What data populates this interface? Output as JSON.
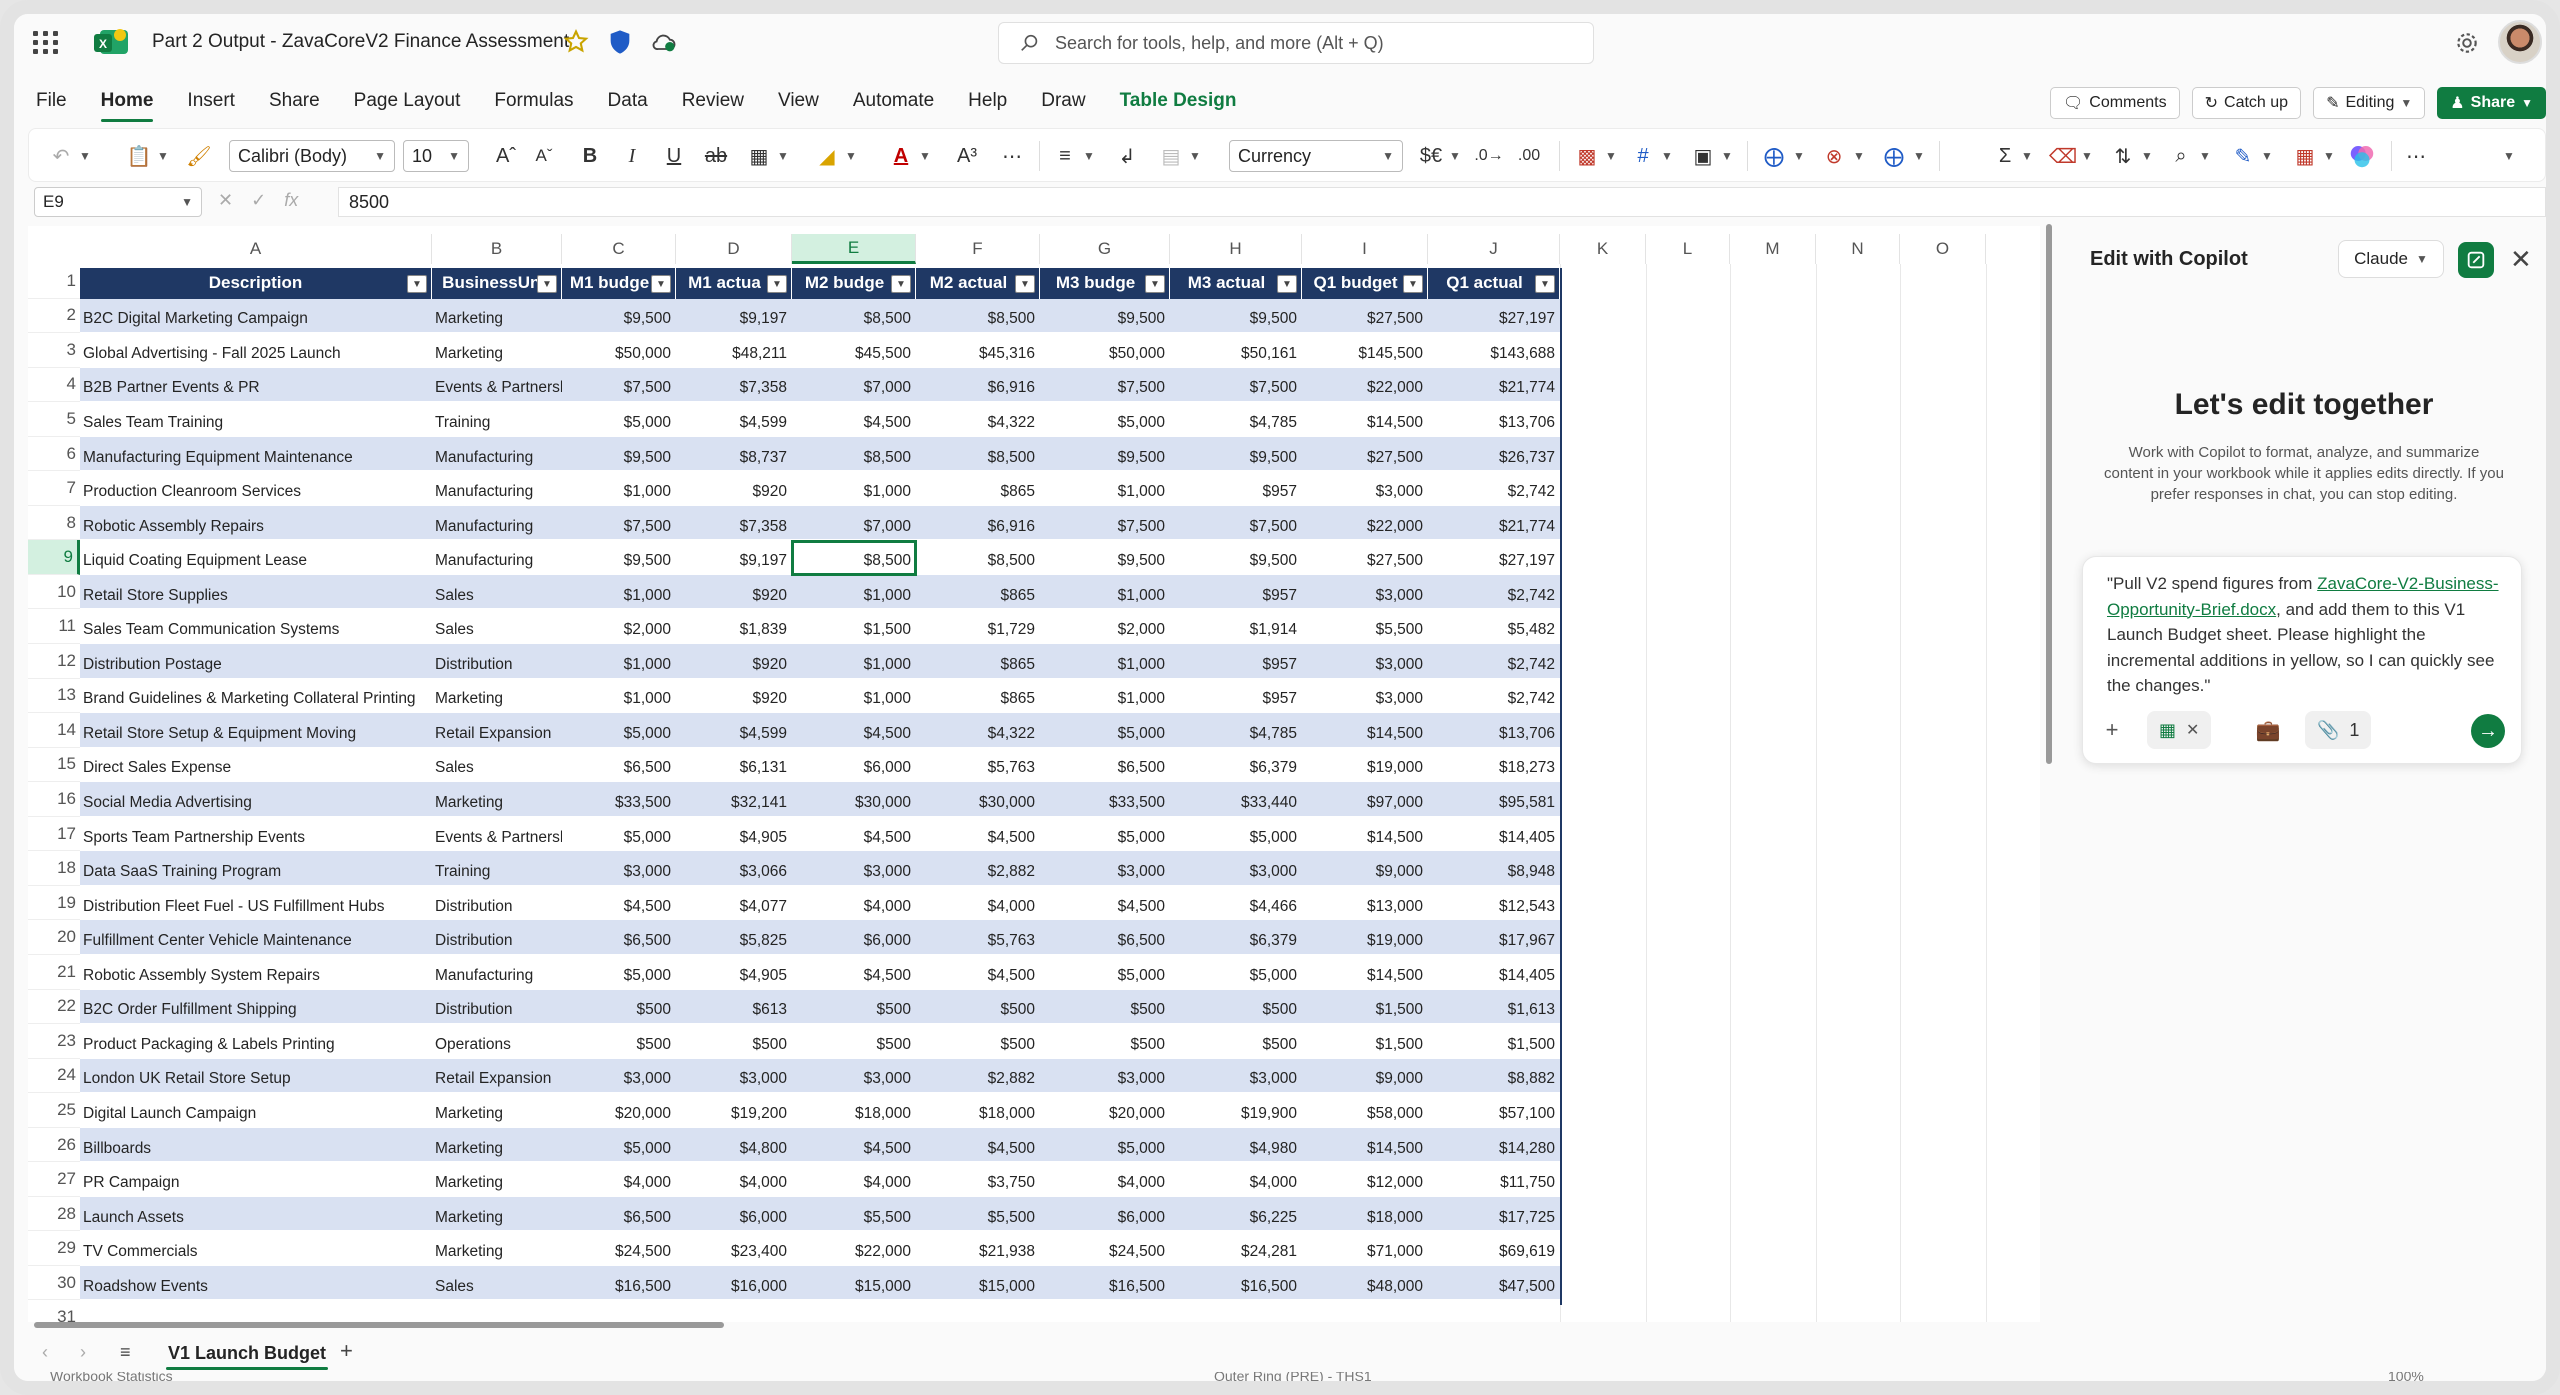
{
  "window": {
    "doc_title": "Part 2 Output - ZavaCoreV2 Finance Assessment",
    "search_placeholder": "Search for tools, help, and more (Alt + Q)"
  },
  "menu": {
    "items": [
      "File",
      "Home",
      "Insert",
      "Share",
      "Page Layout",
      "Formulas",
      "Data",
      "Review",
      "View",
      "Automate",
      "Help",
      "Draw",
      "Table Design"
    ],
    "active": "Home",
    "comments": "Comments",
    "catch_up": "Catch up",
    "editing": "Editing",
    "share": "Share"
  },
  "ribbon": {
    "font_name": "Calibri (Body)",
    "font_size": "10",
    "number_format": "Currency"
  },
  "formula_bar": {
    "name_box": "E9",
    "value": "8500"
  },
  "grid": {
    "columns": [
      "A",
      "B",
      "C",
      "D",
      "E",
      "F",
      "G",
      "H",
      "I",
      "J",
      "K",
      "L",
      "M",
      "N",
      "O"
    ],
    "selected_column": "E",
    "selected_row": "9",
    "headers": [
      "Description",
      "BusinessUnit",
      "M1 budge",
      "M1 actua",
      "M2 budge",
      "M2 actual",
      "M3 budge",
      "M3 actual",
      "Q1 budget",
      "Q1 actual"
    ],
    "row_numbers": [
      "1",
      "2",
      "3",
      "4",
      "5",
      "6",
      "7",
      "8",
      "9",
      "10",
      "11",
      "12",
      "13",
      "14",
      "15",
      "16",
      "17",
      "18",
      "19",
      "20",
      "21",
      "22",
      "23",
      "24",
      "25",
      "26",
      "27",
      "28",
      "29",
      "30",
      "31"
    ],
    "rows": [
      [
        "B2C Digital Marketing Campaign",
        "Marketing",
        "$9,500",
        "$9,197",
        "$8,500",
        "$8,500",
        "$9,500",
        "$9,500",
        "$27,500",
        "$27,197"
      ],
      [
        "Global Advertising - Fall 2025 Launch",
        "Marketing",
        "$50,000",
        "$48,211",
        "$45,500",
        "$45,316",
        "$50,000",
        "$50,161",
        "$145,500",
        "$143,688"
      ],
      [
        "B2B Partner Events & PR",
        "Events & Partnerships",
        "$7,500",
        "$7,358",
        "$7,000",
        "$6,916",
        "$7,500",
        "$7,500",
        "$22,000",
        "$21,774"
      ],
      [
        "Sales Team Training",
        "Training",
        "$5,000",
        "$4,599",
        "$4,500",
        "$4,322",
        "$5,000",
        "$4,785",
        "$14,500",
        "$13,706"
      ],
      [
        "Manufacturing Equipment Maintenance",
        "Manufacturing",
        "$9,500",
        "$8,737",
        "$8,500",
        "$8,500",
        "$9,500",
        "$9,500",
        "$27,500",
        "$26,737"
      ],
      [
        "Production Cleanroom Services",
        "Manufacturing",
        "$1,000",
        "$920",
        "$1,000",
        "$865",
        "$1,000",
        "$957",
        "$3,000",
        "$2,742"
      ],
      [
        "Robotic Assembly Repairs",
        "Manufacturing",
        "$7,500",
        "$7,358",
        "$7,000",
        "$6,916",
        "$7,500",
        "$7,500",
        "$22,000",
        "$21,774"
      ],
      [
        "Liquid Coating Equipment Lease",
        "Manufacturing",
        "$9,500",
        "$9,197",
        "$8,500",
        "$8,500",
        "$9,500",
        "$9,500",
        "$27,500",
        "$27,197"
      ],
      [
        "Retail Store Supplies",
        "Sales",
        "$1,000",
        "$920",
        "$1,000",
        "$865",
        "$1,000",
        "$957",
        "$3,000",
        "$2,742"
      ],
      [
        "Sales Team Communication Systems",
        "Sales",
        "$2,000",
        "$1,839",
        "$1,500",
        "$1,729",
        "$2,000",
        "$1,914",
        "$5,500",
        "$5,482"
      ],
      [
        "Distribution Postage",
        "Distribution",
        "$1,000",
        "$920",
        "$1,000",
        "$865",
        "$1,000",
        "$957",
        "$3,000",
        "$2,742"
      ],
      [
        "Brand Guidelines & Marketing Collateral Printing",
        "Marketing",
        "$1,000",
        "$920",
        "$1,000",
        "$865",
        "$1,000",
        "$957",
        "$3,000",
        "$2,742"
      ],
      [
        "Retail Store Setup & Equipment Moving",
        "Retail Expansion",
        "$5,000",
        "$4,599",
        "$4,500",
        "$4,322",
        "$5,000",
        "$4,785",
        "$14,500",
        "$13,706"
      ],
      [
        "Direct Sales Expense",
        "Sales",
        "$6,500",
        "$6,131",
        "$6,000",
        "$5,763",
        "$6,500",
        "$6,379",
        "$19,000",
        "$18,273"
      ],
      [
        "Social Media Advertising",
        "Marketing",
        "$33,500",
        "$32,141",
        "$30,000",
        "$30,000",
        "$33,500",
        "$33,440",
        "$97,000",
        "$95,581"
      ],
      [
        "Sports Team Partnership Events",
        "Events & Partnerships",
        "$5,000",
        "$4,905",
        "$4,500",
        "$4,500",
        "$5,000",
        "$5,000",
        "$14,500",
        "$14,405"
      ],
      [
        "Data SaaS Training Program",
        "Training",
        "$3,000",
        "$3,066",
        "$3,000",
        "$2,882",
        "$3,000",
        "$3,000",
        "$9,000",
        "$8,948"
      ],
      [
        "Distribution Fleet Fuel - US Fulfillment Hubs",
        "Distribution",
        "$4,500",
        "$4,077",
        "$4,000",
        "$4,000",
        "$4,500",
        "$4,466",
        "$13,000",
        "$12,543"
      ],
      [
        "Fulfillment Center Vehicle Maintenance",
        "Distribution",
        "$6,500",
        "$5,825",
        "$6,000",
        "$5,763",
        "$6,500",
        "$6,379",
        "$19,000",
        "$17,967"
      ],
      [
        "Robotic Assembly System Repairs",
        "Manufacturing",
        "$5,000",
        "$4,905",
        "$4,500",
        "$4,500",
        "$5,000",
        "$5,000",
        "$14,500",
        "$14,405"
      ],
      [
        "B2C Order Fulfillment Shipping",
        "Distribution",
        "$500",
        "$613",
        "$500",
        "$500",
        "$500",
        "$500",
        "$1,500",
        "$1,613"
      ],
      [
        "Product Packaging & Labels Printing",
        "Operations",
        "$500",
        "$500",
        "$500",
        "$500",
        "$500",
        "$500",
        "$1,500",
        "$1,500"
      ],
      [
        "London UK Retail Store Setup",
        "Retail Expansion",
        "$3,000",
        "$3,000",
        "$3,000",
        "$2,882",
        "$3,000",
        "$3,000",
        "$9,000",
        "$8,882"
      ],
      [
        "Digital Launch Campaign",
        "Marketing",
        "$20,000",
        "$19,200",
        "$18,000",
        "$18,000",
        "$20,000",
        "$19,900",
        "$58,000",
        "$57,100"
      ],
      [
        "Billboards",
        "Marketing",
        "$5,000",
        "$4,800",
        "$4,500",
        "$4,500",
        "$5,000",
        "$4,980",
        "$14,500",
        "$14,280"
      ],
      [
        "PR Campaign",
        "Marketing",
        "$4,000",
        "$4,000",
        "$4,000",
        "$3,750",
        "$4,000",
        "$4,000",
        "$12,000",
        "$11,750"
      ],
      [
        "Launch Assets",
        "Marketing",
        "$6,500",
        "$6,000",
        "$5,500",
        "$5,500",
        "$6,000",
        "$6,225",
        "$18,000",
        "$17,725"
      ],
      [
        "TV Commercials",
        "Marketing",
        "$24,500",
        "$23,400",
        "$22,000",
        "$21,938",
        "$24,500",
        "$24,281",
        "$71,000",
        "$69,619"
      ],
      [
        "Roadshow Events",
        "Sales",
        "$16,500",
        "$16,000",
        "$15,000",
        "$15,000",
        "$16,500",
        "$16,500",
        "$48,000",
        "$47,500"
      ]
    ]
  },
  "sheets": {
    "active": "V1 Launch Budget"
  },
  "status": {
    "left": "Workbook Statistics",
    "center": "Outer Ring (PRE) - THS1",
    "zoom": "100%"
  },
  "copilot": {
    "title": "Edit with Copilot",
    "model": "Claude",
    "heading": "Let's edit together",
    "description": "Work with Copilot to format, analyze, and summarize content in your workbook while it applies edits directly. If you prefer responses in chat, you can stop editing.",
    "prompt_pre": "\"Pull V2 spend figures from ",
    "prompt_link": "ZavaCore-V2-Business-Opportunity-Brief.docx",
    "prompt_post": ", and add them to this V1 Launch Budget sheet. Please highlight the incremental additions in yellow, so I can quickly see the changes.\"",
    "attachment_count": "1"
  },
  "colors": {
    "accent": "#107c41",
    "table_header": "#1f3864",
    "band_light": "#d9e1f2",
    "band_white": "#ffffff"
  }
}
